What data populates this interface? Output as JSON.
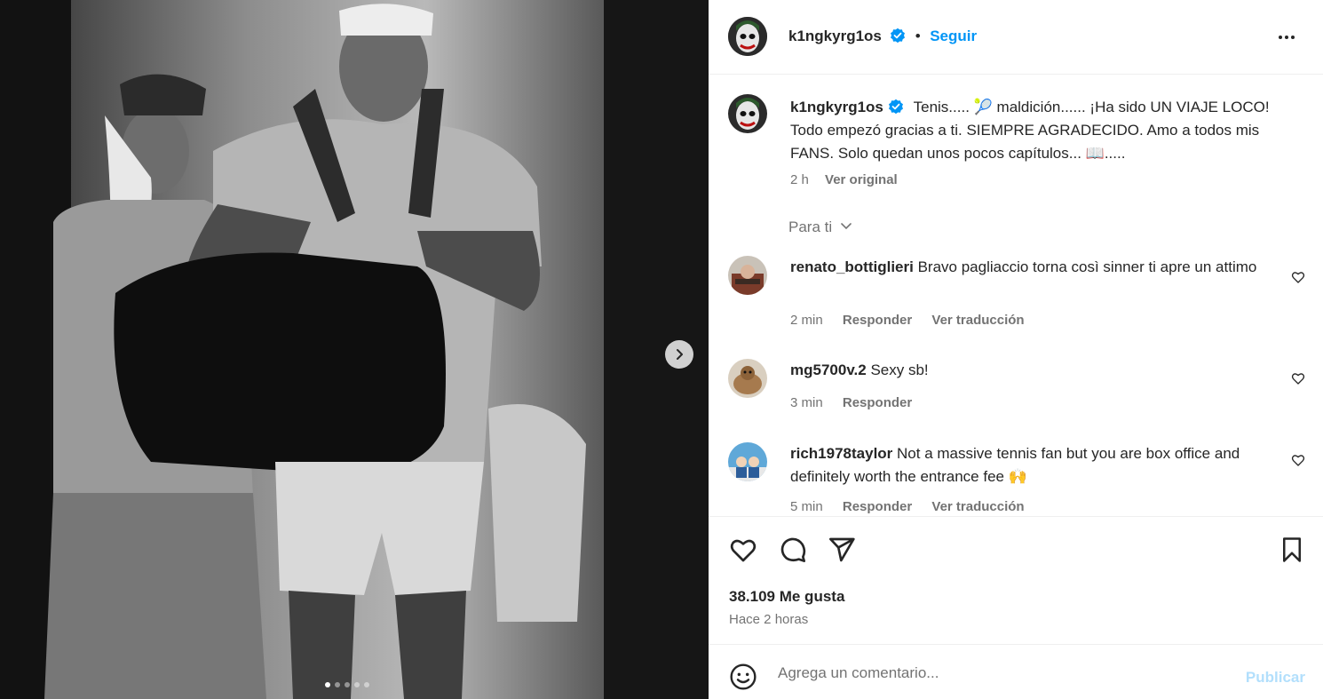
{
  "post": {
    "username": "k1ngkyrg1os",
    "follow_label": "Seguir",
    "separator": "•",
    "caption": "Tenis..... 🎾 maldición...... ¡Ha sido UN VIAJE LOCO! Todo empezó gracias a ti. SIEMPRE AGRADECIDO. Amo a todos mis FANS. Solo quedan unos pocos capítulos... 📖.....",
    "caption_time": "2 h",
    "see_original": "Ver original",
    "for_you": "Para ti",
    "carousel": {
      "slides": 5,
      "active": 1
    }
  },
  "comments": [
    {
      "username": "renato_bottiglieri",
      "text": "Bravo pagliaccio torna così sinner ti apre un attimo",
      "time": "2 min",
      "reply": "Responder",
      "translate": "Ver traducción"
    },
    {
      "username": "mg5700v.2",
      "text": "Sexy sb!",
      "time": "3 min",
      "reply": "Responder"
    },
    {
      "username": "rich1978taylor",
      "text": "Not a massive tennis fan but you are box office and definitely worth the entrance fee 🙌",
      "time": "5 min",
      "reply": "Responder",
      "translate": "Ver traducción"
    }
  ],
  "stats": {
    "likes": "38.109 Me gusta",
    "posted": "Hace 2 horas"
  },
  "composer": {
    "placeholder": "Agrega un comentario...",
    "publish": "Publicar"
  },
  "colors": {
    "accent": "#0095f6",
    "publish_disabled": "#b2dffc",
    "secondary_text": "#737373"
  }
}
